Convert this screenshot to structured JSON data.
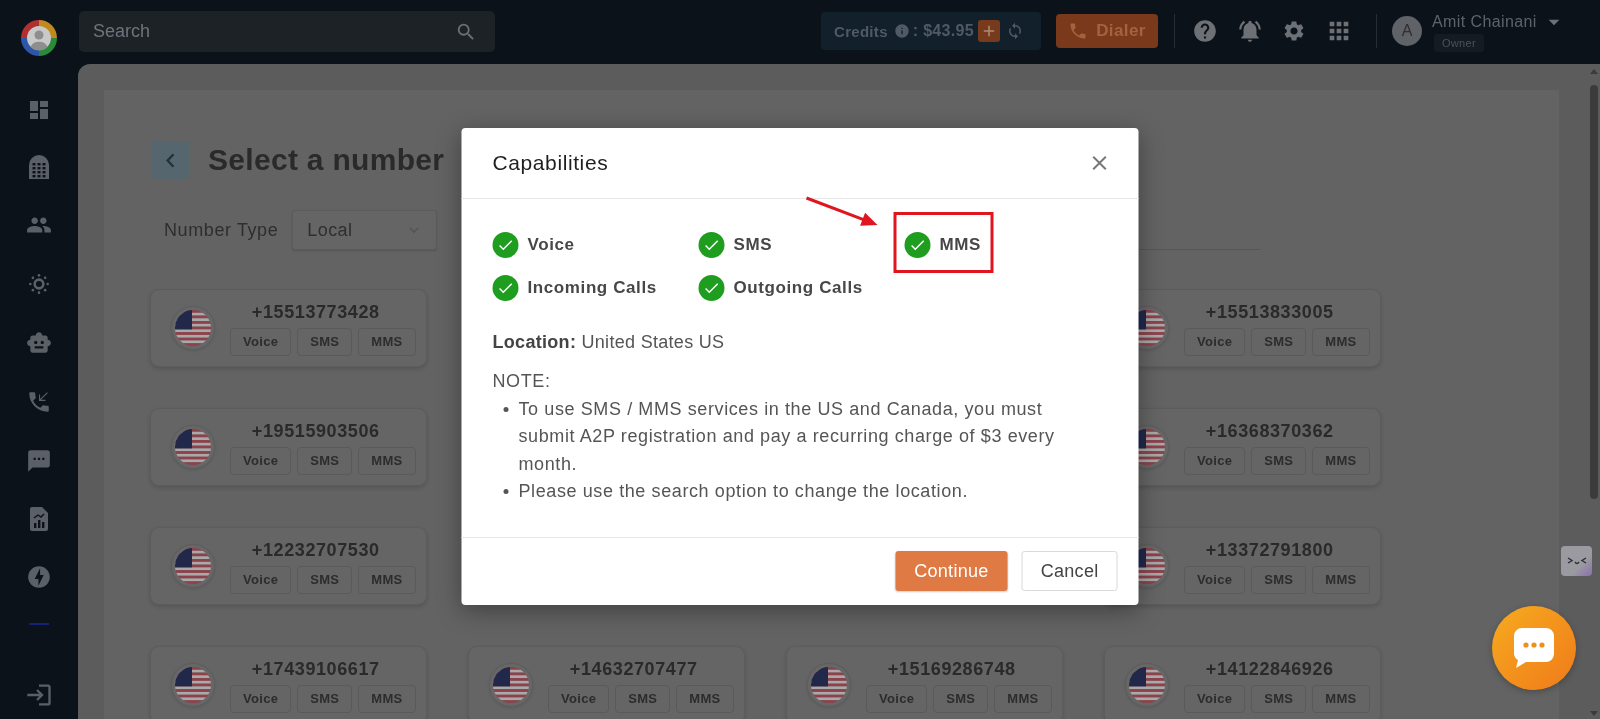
{
  "topbar": {
    "search": {
      "placeholder": "Search"
    },
    "credits": {
      "label": "Credits",
      "amount": ": $43.95"
    },
    "dialer": {
      "label": "Dialer"
    },
    "user": {
      "initial": "A",
      "name": "Amit Chainani",
      "role": "Owner"
    }
  },
  "page": {
    "title": "Select a number",
    "filter": {
      "label": "Number Type",
      "value": "Local"
    },
    "number_rows": [
      {
        "numbers": [
          {
            "number": "+15513773428",
            "capabilities": [
              "Voice",
              "SMS",
              "MMS"
            ]
          },
          {
            "number": "+15513833005",
            "capabilities": [
              "Voice",
              "SMS",
              "MMS"
            ]
          }
        ]
      },
      {
        "numbers": [
          {
            "number": "+19515903506",
            "capabilities": [
              "Voice",
              "SMS",
              "MMS"
            ]
          },
          {
            "number": "+16368370362",
            "capabilities": [
              "Voice",
              "SMS",
              "MMS"
            ]
          }
        ]
      },
      {
        "numbers": [
          {
            "number": "+12232707530",
            "capabilities": [
              "Voice",
              "SMS",
              "MMS"
            ]
          },
          {
            "number": "+13372791800",
            "capabilities": [
              "Voice",
              "SMS",
              "MMS"
            ]
          }
        ]
      },
      {
        "numbers": [
          {
            "number": "+17439106617",
            "capabilities": [
              "Voice",
              "SMS",
              "MMS"
            ]
          },
          {
            "number": "+14632707477",
            "capabilities": [
              "Voice",
              "SMS",
              "MMS"
            ]
          },
          {
            "number": "+15169286748",
            "capabilities": [
              "Voice",
              "SMS",
              "MMS"
            ]
          },
          {
            "number": "+14122846926",
            "capabilities": [
              "Voice",
              "SMS",
              "MMS"
            ]
          }
        ]
      }
    ]
  },
  "modal": {
    "title": "Capabilities",
    "capabilities": [
      {
        "label": "Voice",
        "checked": true,
        "highlighted": false
      },
      {
        "label": "SMS",
        "checked": true,
        "highlighted": false
      },
      {
        "label": "MMS",
        "checked": true,
        "highlighted": true
      },
      {
        "label": "Incoming Calls",
        "checked": true,
        "highlighted": false
      },
      {
        "label": "Outgoing Calls",
        "checked": true,
        "highlighted": false
      }
    ],
    "location": "**Location:** United States US",
    "note_heading": "NOTE:",
    "notes": [
      "To use SMS / MMS services in the US and Canada, you must submit A2P registration and pay a recurring charge of $3 every month.",
      "Please use the search option to change the location."
    ],
    "buttons": [
      {
        "label": "Continue",
        "kind": "primary"
      },
      {
        "label": "Cancel",
        "kind": "secondary"
      }
    ]
  }
}
